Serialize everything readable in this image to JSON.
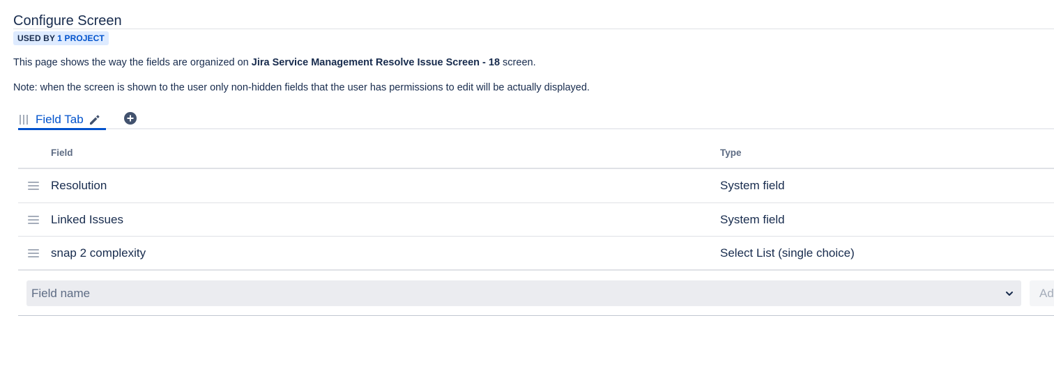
{
  "page": {
    "title": "Configure Screen",
    "used_by_prefix": "USED BY",
    "used_by_count": "1 PROJECT",
    "description_prefix": "This page shows the way the fields are organized on",
    "screen_name": "Jira Service Management Resolve Issue Screen - 18",
    "description_suffix": "screen.",
    "note": "Note: when the screen is shown to the user only non-hidden fields that the user has permissions to edit will be actually displayed."
  },
  "tabs": [
    {
      "label": "Field Tab",
      "selected": true
    }
  ],
  "icons": {
    "tab_drag": "drag-handle-icon",
    "tab_edit": "pencil-icon",
    "add_tab": "add-circle-icon",
    "row_drag": "drag-handle-icon",
    "select_chevron": "chevron-down-icon"
  },
  "table": {
    "headers": {
      "field": "Field",
      "type": "Type"
    },
    "rows": [
      {
        "field": "Resolution",
        "type": "System field"
      },
      {
        "field": "Linked Issues",
        "type": "System field"
      },
      {
        "field": "snap 2 complexity",
        "type": "Select List (single choice)"
      }
    ]
  },
  "add_field": {
    "placeholder": "Field name",
    "button_label": "Add"
  },
  "colors": {
    "accent": "#0052cc",
    "text": "#172b4d",
    "subtle_text": "#5e6c84",
    "lozenge_bg": "#deebff",
    "border": "#dfe1e6",
    "select_bg": "#ebecf0"
  }
}
